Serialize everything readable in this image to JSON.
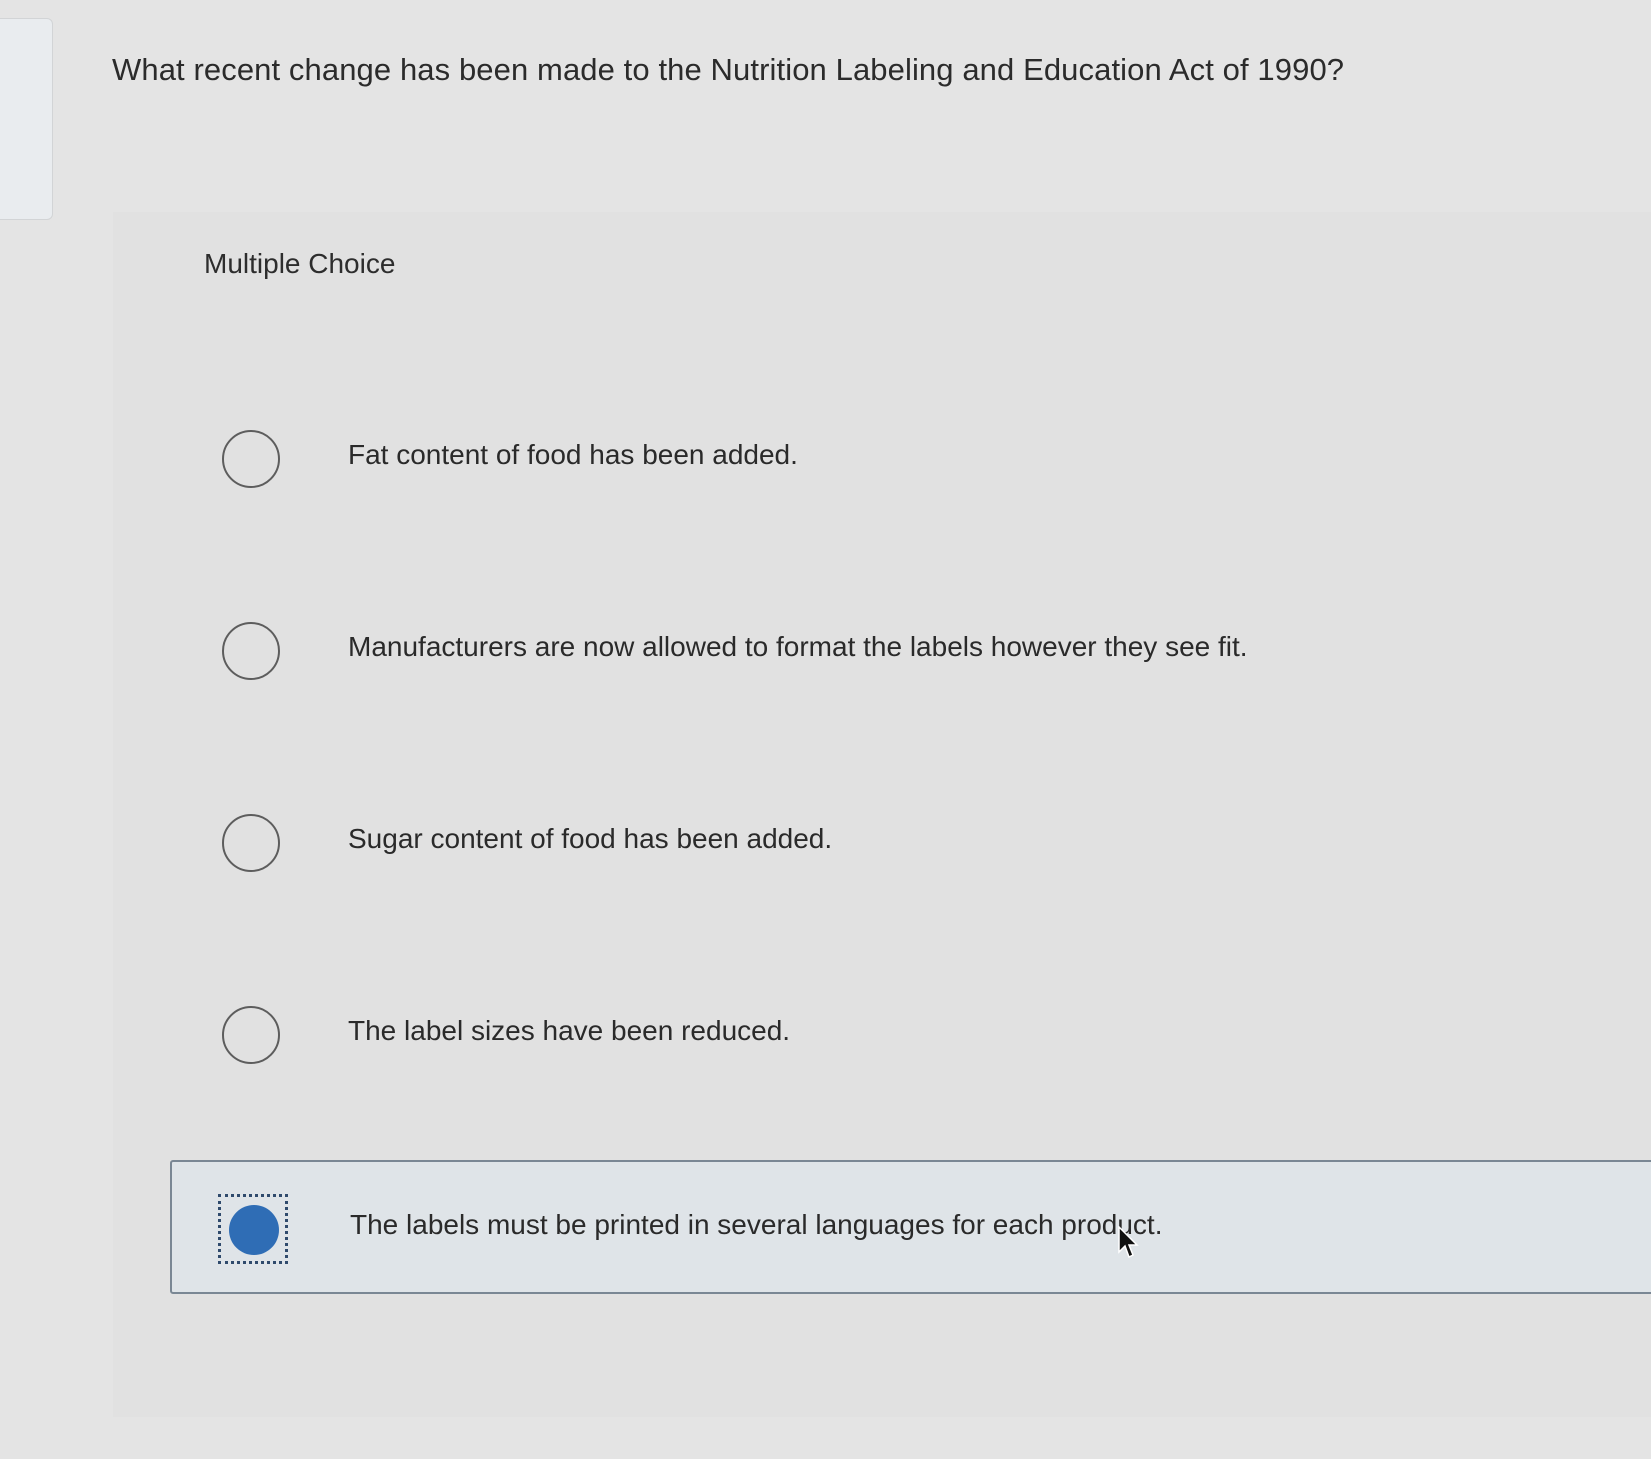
{
  "question": {
    "text": "What recent change has been made to the Nutrition Labeling and Education Act of 1990?"
  },
  "question_type": "Multiple Choice",
  "options": [
    {
      "label": "Fat content of food has been added.",
      "selected": false
    },
    {
      "label": "Manufacturers are now allowed to format the labels however they see fit.",
      "selected": false
    },
    {
      "label": "Sugar content of food has been added.",
      "selected": false
    },
    {
      "label": "The label sizes have been reduced.",
      "selected": false
    },
    {
      "label": "The labels must be printed in several languages for each product.",
      "selected": true
    }
  ],
  "colors": {
    "selected_radio": "#2f6db5",
    "selected_row_border": "#7a8794"
  }
}
